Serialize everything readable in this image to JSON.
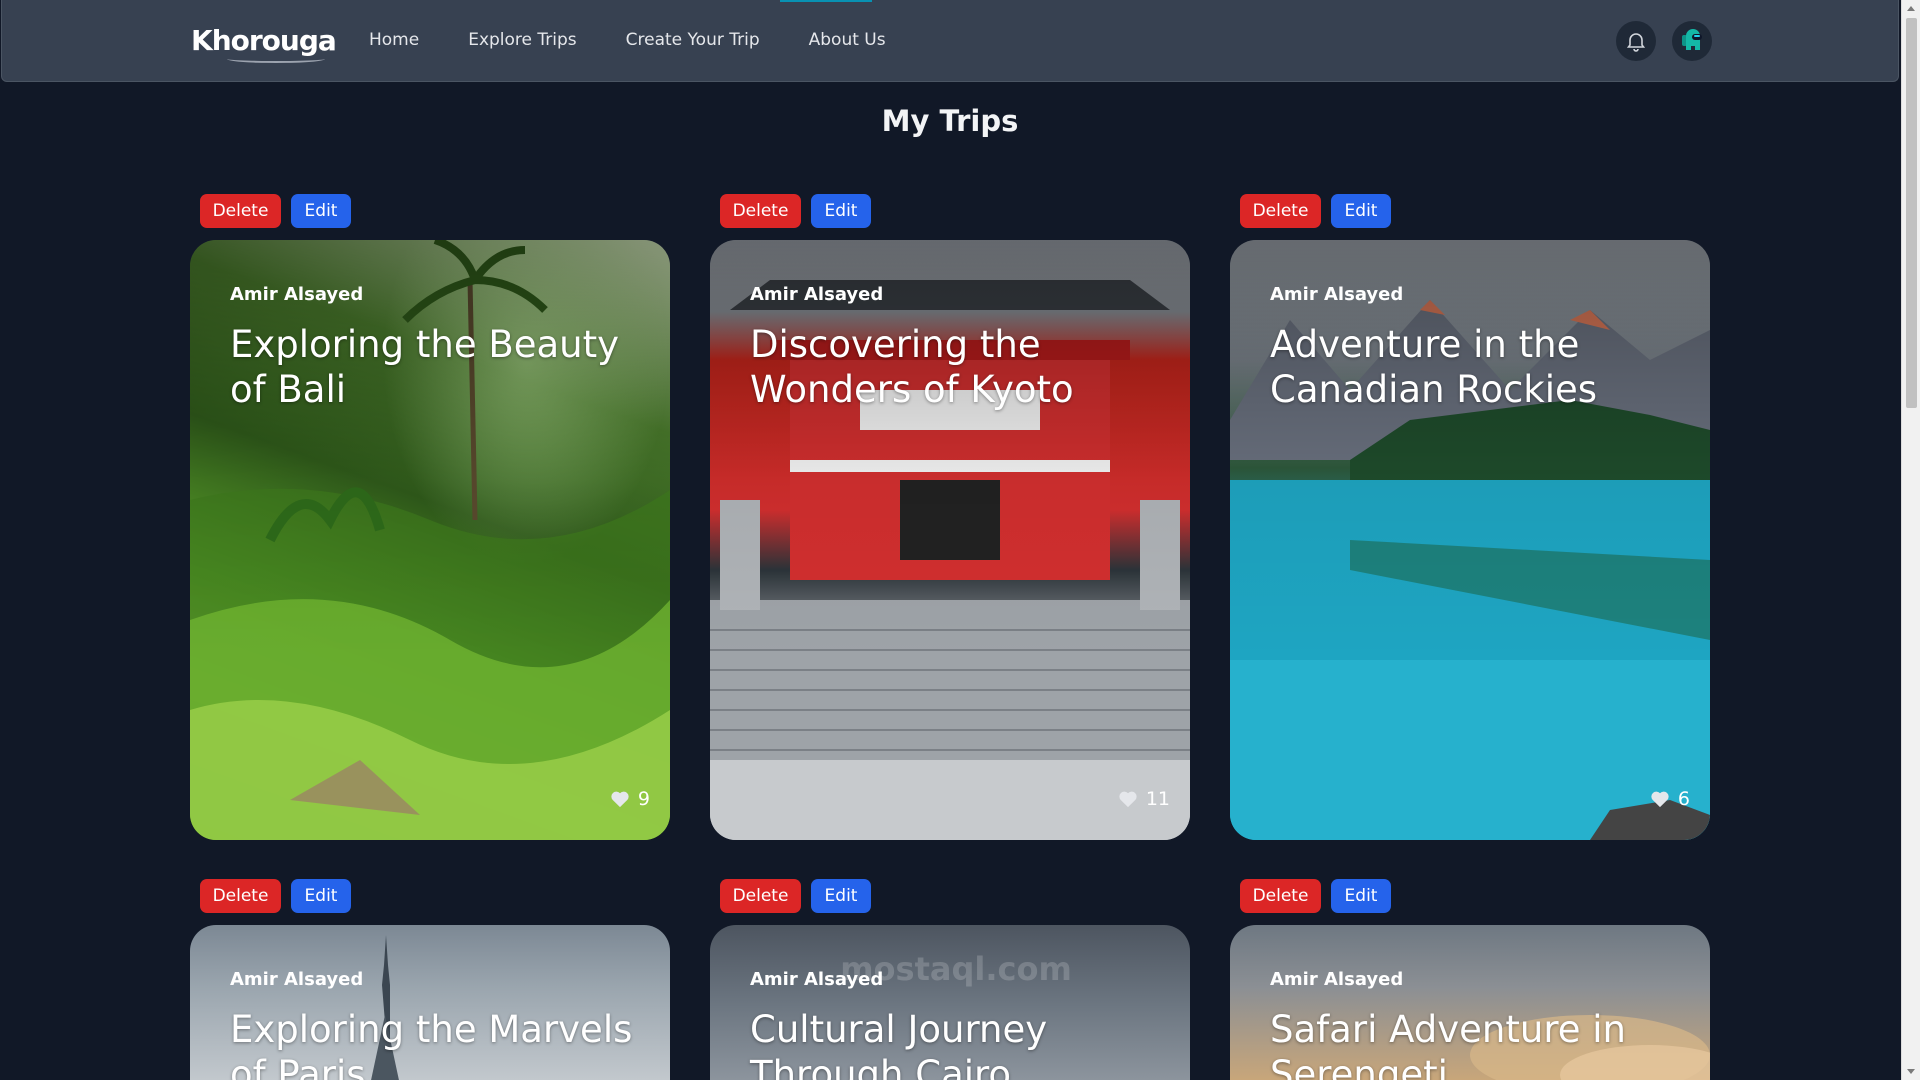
{
  "navbar": {
    "brand": "Khorouga",
    "links": [
      "Home",
      "Explore Trips",
      "Create Your Trip",
      "About Us"
    ],
    "bell_icon": "bell-icon",
    "avatar_icon": "among-us-avatar-icon"
  },
  "page": {
    "title": "My Trips"
  },
  "actions": {
    "delete_label": "Delete",
    "edit_label": "Edit"
  },
  "trips": [
    {
      "author": "Amir Alsayed",
      "title": "Exploring the Beauty of Bali",
      "likes": "9"
    },
    {
      "author": "Amir Alsayed",
      "title": "Discovering the Wonders of Kyoto",
      "likes": "11"
    },
    {
      "author": "Amir Alsayed",
      "title": "Adventure in the Canadian Rockies",
      "likes": "6"
    },
    {
      "author": "Amir Alsayed",
      "title": "Exploring the Marvels of Paris",
      "likes": ""
    },
    {
      "author": "Amir Alsayed",
      "title": "Cultural Journey Through Cairo",
      "likes": ""
    },
    {
      "author": "Amir Alsayed",
      "title": "Safari Adventure in Serengeti",
      "likes": ""
    }
  ],
  "watermark": "mostaql.com",
  "colors": {
    "background": "#111827",
    "navbar": "#374151",
    "delete": "#dc2626",
    "edit": "#2563eb"
  }
}
